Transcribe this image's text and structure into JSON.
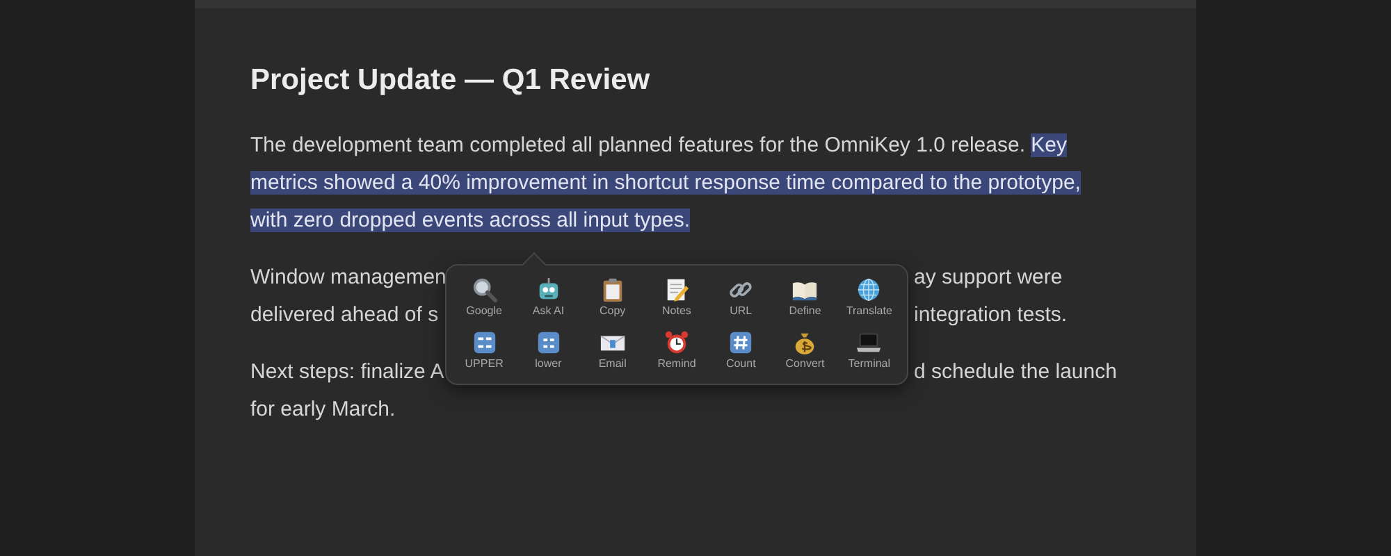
{
  "document": {
    "title": "Project Update — Q1 Review",
    "paragraph_1": [
      {
        "text": "The development team completed all planned features for the OmniKey 1.0 release. ",
        "selected": false
      },
      {
        "text": "Key metrics showed a 40% improvement in shortcut response time compared to the prototype, with zero dropped events across all input types.",
        "selected": true
      }
    ],
    "paragraph_2_lines": [
      {
        "left": "Window managemen",
        "right": "ay support were"
      },
      {
        "left": "delivered ahead of s",
        "right": "integration tests."
      }
    ],
    "paragraph_3_lines": [
      {
        "left": "Next steps: finalize A",
        "right": "d schedule the launch"
      },
      {
        "left": "for early March."
      }
    ]
  },
  "action_popup": {
    "actions": [
      {
        "label": "Google"
      },
      {
        "label": "Ask AI"
      },
      {
        "label": "Copy"
      },
      {
        "label": "Notes"
      },
      {
        "label": "URL"
      },
      {
        "label": "Define"
      },
      {
        "label": "Translate"
      },
      {
        "label": "UPPER"
      },
      {
        "label": "lower"
      },
      {
        "label": "Email"
      },
      {
        "label": "Remind"
      },
      {
        "label": "Count"
      },
      {
        "label": "Convert"
      },
      {
        "label": "Terminal"
      }
    ]
  }
}
